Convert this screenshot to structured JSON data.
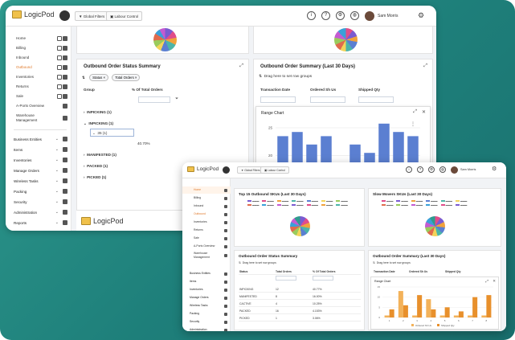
{
  "app": {
    "name": "LogicPod"
  },
  "topbar": {
    "global_filters": "Global Filters",
    "labour_control": "Labour Control",
    "user_name": "Sam Morris",
    "info_icon": "info-icon",
    "help_icon": "help-icon",
    "globe_icon": "globe-icon"
  },
  "sidebar_back": {
    "sub_items": [
      "Home",
      "Billing",
      "Inbound",
      "Outbound",
      "Inventories",
      "Returns",
      "Sale",
      "A-Ports Overview",
      "Warehouse Management"
    ],
    "main_items": [
      "Business Entities",
      "Items",
      "Inventories",
      "Manage Orders",
      "Wireless Tasks",
      "Packing",
      "Security",
      "Administration",
      "Reports"
    ]
  },
  "back_cards": {
    "status_summary": {
      "title": "Outbound Order Status Summary",
      "pills": [
        "Status",
        "Total Orders"
      ],
      "col_group": "Group",
      "col_pct": "% Of Total Orders",
      "rows": [
        "INPICKING (1)",
        "INPICKING (1)",
        "35 (1)",
        "MANIFESTED (1)",
        "PACKED (1)",
        "PICKED (1)"
      ],
      "pct_value": "40.70%"
    },
    "order_summary": {
      "title": "Outbound Order Summary (Last 30 Days)",
      "dropzone": "Drag here to set row groups",
      "cols": [
        "Transaction Date",
        "Ordered Sh Us",
        "Shipped Qty"
      ],
      "range_chart_title": "Range Chart"
    }
  },
  "back_chart": {
    "type": "bar",
    "categories": [
      "1",
      "2",
      "3",
      "4",
      "5",
      "6",
      "7",
      "8",
      "9",
      "10"
    ],
    "values": [
      23,
      24,
      21,
      23,
      12,
      21,
      19,
      26,
      24,
      23
    ],
    "y_ticks": [
      "25",
      "20",
      "15",
      "10"
    ],
    "ylim": [
      10,
      25
    ],
    "color": "#5b7fd1"
  },
  "front": {
    "top15_title": "Top 15 Outbound SKUs (Last 30 Days)",
    "slow_title": "Slow Movers SKUs (Last 30 Days)",
    "status_summary": {
      "title": "Outbound Order Status Summary",
      "dropzone": "Drag here to set row groups",
      "cols": [
        "Status",
        "Total Orders",
        "% Of Total Orders"
      ],
      "rows": [
        [
          "INPICKING",
          "12",
          "40.77%"
        ],
        [
          "MANIFESTED",
          "8",
          "16.00%"
        ],
        [
          "CACTIVE",
          "4",
          "10.25%"
        ],
        [
          "PACKED",
          "16",
          "4.153%"
        ],
        [
          "PICKED",
          "1",
          "3.06%"
        ]
      ]
    },
    "order_summary": {
      "title": "Outbound Order Summary (Last 30 Days)",
      "dropzone": "Drag here to set row groups",
      "cols": [
        "Transaction Date",
        "Ordered Sh Us",
        "Shipped Qty"
      ],
      "range_chart_title": "Range Chart",
      "legend": [
        "Ordered Sh Us",
        "Shipped Qty"
      ]
    },
    "sidebar_sub": [
      "Home",
      "Billing",
      "Inbound",
      "Outbound",
      "Inventories",
      "Returns",
      "Sale",
      "A-Ports Overview",
      "Warehouse Management"
    ],
    "sidebar_main": [
      "Business Entities",
      "Items",
      "Inventories",
      "Manage Orders",
      "Wireless Tasks",
      "Packing",
      "Security",
      "Administration"
    ]
  },
  "chart_data": {
    "type": "bar",
    "categories": [
      "1",
      "2",
      "3",
      "4",
      "5",
      "6",
      "7",
      "8"
    ],
    "series": [
      {
        "name": "Ordered Sh Us",
        "values": [
          1,
          13,
          1,
          9,
          1,
          1,
          1,
          1
        ]
      },
      {
        "name": "Shipped Qty",
        "values": [
          4,
          6,
          11,
          4,
          5,
          3,
          10,
          11
        ]
      }
    ],
    "colors": [
      "#f3b25a",
      "#e8902c"
    ],
    "ylim": [
      0,
      15
    ],
    "y_ticks": [
      "15",
      "10",
      "5",
      "0"
    ]
  }
}
